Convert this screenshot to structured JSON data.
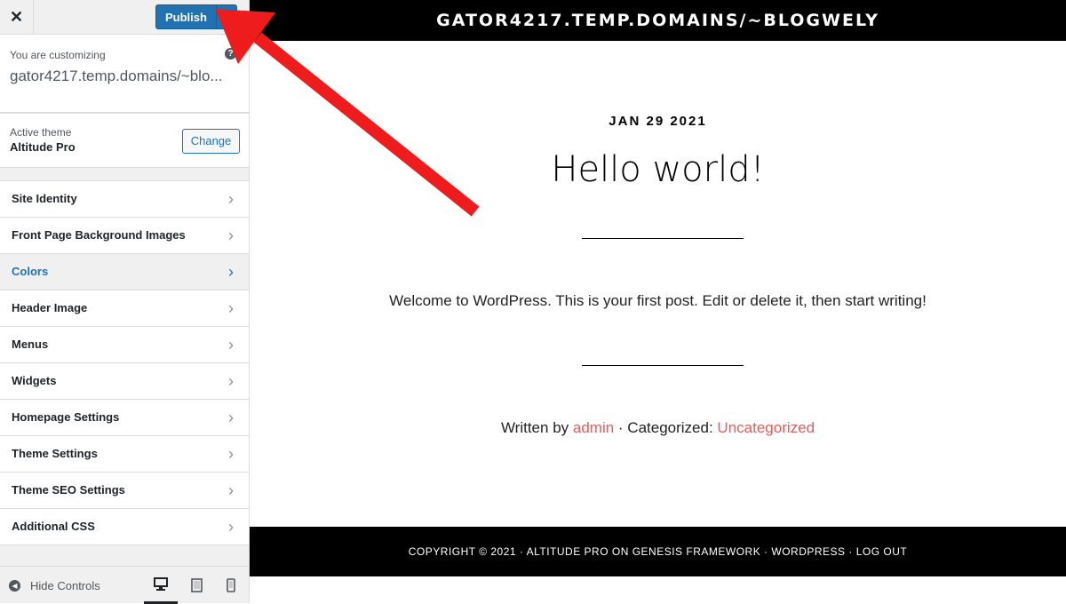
{
  "sidebar": {
    "close_glyph": "✕",
    "publish_label": "Publish",
    "gear_glyph": "⚙",
    "customizing_label": "You are customizing",
    "help_glyph": "?",
    "site_url": "gator4217.temp.domains/~blo...",
    "theme_label": "Active theme",
    "theme_name": "Altitude Pro",
    "change_label": "Change",
    "menu_items": [
      {
        "label": "Site Identity"
      },
      {
        "label": "Front Page Background Images"
      },
      {
        "label": "Colors",
        "active": true
      },
      {
        "label": "Header Image"
      },
      {
        "label": "Menus"
      },
      {
        "label": "Widgets"
      },
      {
        "label": "Homepage Settings"
      },
      {
        "label": "Theme Settings"
      },
      {
        "label": "Theme SEO Settings"
      },
      {
        "label": "Additional CSS"
      }
    ],
    "chevron_glyph": "›",
    "hide_controls_label": "Hide Controls",
    "devices": [
      "desktop-icon",
      "tablet-icon",
      "mobile-icon"
    ],
    "active_device": "desktop"
  },
  "preview": {
    "site_title": "GATOR4217.TEMP.DOMAINS/~BLOGWELY",
    "post_date": "JAN 29 2021",
    "post_title": "Hello world!",
    "post_body": "Welcome to WordPress. This is your first post. Edit or delete it, then start writing!",
    "meta_written_by": "Written by ",
    "meta_author": "admin",
    "meta_separator": " · Categorized: ",
    "meta_category": "Uncategorized",
    "footer_text": "COPYRIGHT © 2021 · ALTITUDE PRO ON GENESIS FRAMEWORK · WORDPRESS · LOG OUT"
  },
  "colors": {
    "accent_blue": "#2271b1",
    "link_red": "#e0605f",
    "arrow_red": "#ee1c1c"
  },
  "annotation": {
    "type": "arrow",
    "points_to": "publish-button"
  }
}
